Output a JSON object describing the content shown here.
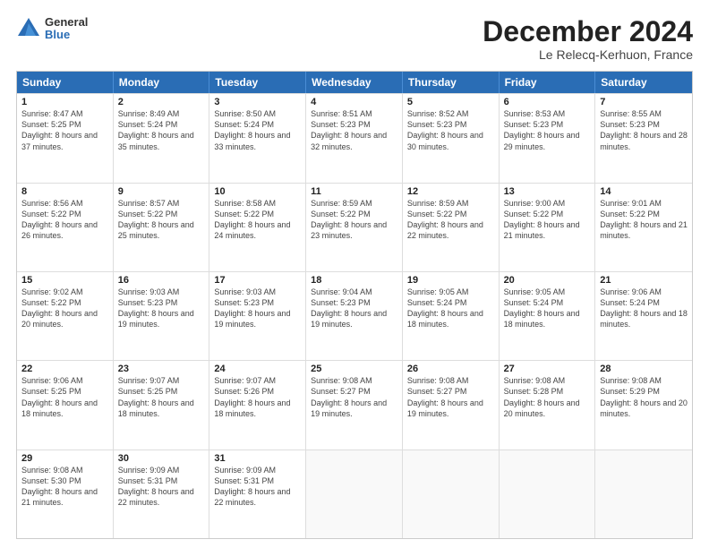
{
  "logo": {
    "general": "General",
    "blue": "Blue"
  },
  "title": "December 2024",
  "subtitle": "Le Relecq-Kerhuon, France",
  "days": [
    "Sunday",
    "Monday",
    "Tuesday",
    "Wednesday",
    "Thursday",
    "Friday",
    "Saturday"
  ],
  "weeks": [
    [
      {
        "day": "1",
        "sunrise": "Sunrise: 8:47 AM",
        "sunset": "Sunset: 5:25 PM",
        "daylight": "Daylight: 8 hours and 37 minutes."
      },
      {
        "day": "2",
        "sunrise": "Sunrise: 8:49 AM",
        "sunset": "Sunset: 5:24 PM",
        "daylight": "Daylight: 8 hours and 35 minutes."
      },
      {
        "day": "3",
        "sunrise": "Sunrise: 8:50 AM",
        "sunset": "Sunset: 5:24 PM",
        "daylight": "Daylight: 8 hours and 33 minutes."
      },
      {
        "day": "4",
        "sunrise": "Sunrise: 8:51 AM",
        "sunset": "Sunset: 5:23 PM",
        "daylight": "Daylight: 8 hours and 32 minutes."
      },
      {
        "day": "5",
        "sunrise": "Sunrise: 8:52 AM",
        "sunset": "Sunset: 5:23 PM",
        "daylight": "Daylight: 8 hours and 30 minutes."
      },
      {
        "day": "6",
        "sunrise": "Sunrise: 8:53 AM",
        "sunset": "Sunset: 5:23 PM",
        "daylight": "Daylight: 8 hours and 29 minutes."
      },
      {
        "day": "7",
        "sunrise": "Sunrise: 8:55 AM",
        "sunset": "Sunset: 5:23 PM",
        "daylight": "Daylight: 8 hours and 28 minutes."
      }
    ],
    [
      {
        "day": "8",
        "sunrise": "Sunrise: 8:56 AM",
        "sunset": "Sunset: 5:22 PM",
        "daylight": "Daylight: 8 hours and 26 minutes."
      },
      {
        "day": "9",
        "sunrise": "Sunrise: 8:57 AM",
        "sunset": "Sunset: 5:22 PM",
        "daylight": "Daylight: 8 hours and 25 minutes."
      },
      {
        "day": "10",
        "sunrise": "Sunrise: 8:58 AM",
        "sunset": "Sunset: 5:22 PM",
        "daylight": "Daylight: 8 hours and 24 minutes."
      },
      {
        "day": "11",
        "sunrise": "Sunrise: 8:59 AM",
        "sunset": "Sunset: 5:22 PM",
        "daylight": "Daylight: 8 hours and 23 minutes."
      },
      {
        "day": "12",
        "sunrise": "Sunrise: 8:59 AM",
        "sunset": "Sunset: 5:22 PM",
        "daylight": "Daylight: 8 hours and 22 minutes."
      },
      {
        "day": "13",
        "sunrise": "Sunrise: 9:00 AM",
        "sunset": "Sunset: 5:22 PM",
        "daylight": "Daylight: 8 hours and 21 minutes."
      },
      {
        "day": "14",
        "sunrise": "Sunrise: 9:01 AM",
        "sunset": "Sunset: 5:22 PM",
        "daylight": "Daylight: 8 hours and 21 minutes."
      }
    ],
    [
      {
        "day": "15",
        "sunrise": "Sunrise: 9:02 AM",
        "sunset": "Sunset: 5:22 PM",
        "daylight": "Daylight: 8 hours and 20 minutes."
      },
      {
        "day": "16",
        "sunrise": "Sunrise: 9:03 AM",
        "sunset": "Sunset: 5:23 PM",
        "daylight": "Daylight: 8 hours and 19 minutes."
      },
      {
        "day": "17",
        "sunrise": "Sunrise: 9:03 AM",
        "sunset": "Sunset: 5:23 PM",
        "daylight": "Daylight: 8 hours and 19 minutes."
      },
      {
        "day": "18",
        "sunrise": "Sunrise: 9:04 AM",
        "sunset": "Sunset: 5:23 PM",
        "daylight": "Daylight: 8 hours and 19 minutes."
      },
      {
        "day": "19",
        "sunrise": "Sunrise: 9:05 AM",
        "sunset": "Sunset: 5:24 PM",
        "daylight": "Daylight: 8 hours and 18 minutes."
      },
      {
        "day": "20",
        "sunrise": "Sunrise: 9:05 AM",
        "sunset": "Sunset: 5:24 PM",
        "daylight": "Daylight: 8 hours and 18 minutes."
      },
      {
        "day": "21",
        "sunrise": "Sunrise: 9:06 AM",
        "sunset": "Sunset: 5:24 PM",
        "daylight": "Daylight: 8 hours and 18 minutes."
      }
    ],
    [
      {
        "day": "22",
        "sunrise": "Sunrise: 9:06 AM",
        "sunset": "Sunset: 5:25 PM",
        "daylight": "Daylight: 8 hours and 18 minutes."
      },
      {
        "day": "23",
        "sunrise": "Sunrise: 9:07 AM",
        "sunset": "Sunset: 5:25 PM",
        "daylight": "Daylight: 8 hours and 18 minutes."
      },
      {
        "day": "24",
        "sunrise": "Sunrise: 9:07 AM",
        "sunset": "Sunset: 5:26 PM",
        "daylight": "Daylight: 8 hours and 18 minutes."
      },
      {
        "day": "25",
        "sunrise": "Sunrise: 9:08 AM",
        "sunset": "Sunset: 5:27 PM",
        "daylight": "Daylight: 8 hours and 19 minutes."
      },
      {
        "day": "26",
        "sunrise": "Sunrise: 9:08 AM",
        "sunset": "Sunset: 5:27 PM",
        "daylight": "Daylight: 8 hours and 19 minutes."
      },
      {
        "day": "27",
        "sunrise": "Sunrise: 9:08 AM",
        "sunset": "Sunset: 5:28 PM",
        "daylight": "Daylight: 8 hours and 20 minutes."
      },
      {
        "day": "28",
        "sunrise": "Sunrise: 9:08 AM",
        "sunset": "Sunset: 5:29 PM",
        "daylight": "Daylight: 8 hours and 20 minutes."
      }
    ],
    [
      {
        "day": "29",
        "sunrise": "Sunrise: 9:08 AM",
        "sunset": "Sunset: 5:30 PM",
        "daylight": "Daylight: 8 hours and 21 minutes."
      },
      {
        "day": "30",
        "sunrise": "Sunrise: 9:09 AM",
        "sunset": "Sunset: 5:31 PM",
        "daylight": "Daylight: 8 hours and 22 minutes."
      },
      {
        "day": "31",
        "sunrise": "Sunrise: 9:09 AM",
        "sunset": "Sunset: 5:31 PM",
        "daylight": "Daylight: 8 hours and 22 minutes."
      },
      null,
      null,
      null,
      null
    ]
  ]
}
